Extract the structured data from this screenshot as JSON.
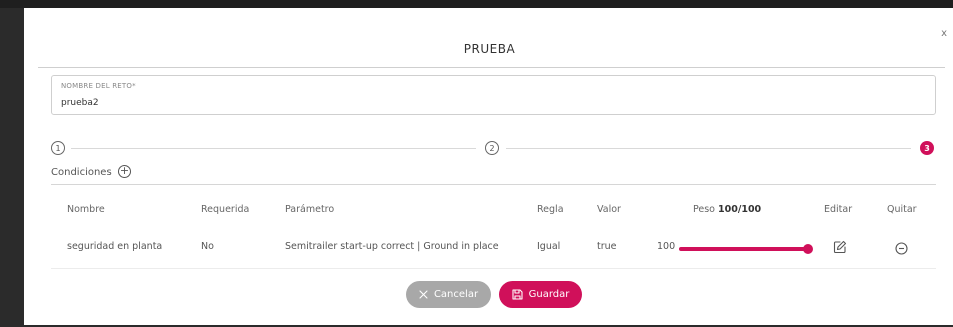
{
  "modal": {
    "title": "PRUEBA",
    "close_label": "x"
  },
  "name_field": {
    "label": "NOMBRE DEL RETO*",
    "value": "prueba2"
  },
  "steps": [
    "1",
    "2",
    "3"
  ],
  "conditions": {
    "label": "Condiciones",
    "add_label": "+"
  },
  "table": {
    "headers": {
      "nombre": "Nombre",
      "requerida": "Requerida",
      "parametro": "Parámetro",
      "regla": "Regla",
      "valor": "Valor",
      "peso": "Peso",
      "peso_total": "100/100",
      "editar": "Editar",
      "quitar": "Quitar"
    },
    "rows": [
      {
        "nombre": "seguridad en planta",
        "requerida": "No",
        "parametro": "Semitrailer start-up correct | Ground in place",
        "regla": "Igual",
        "valor": "true",
        "peso": "100",
        "peso_fraction": 1.0
      }
    ]
  },
  "buttons": {
    "cancel": "Cancelar",
    "save": "Guardar"
  },
  "colors": {
    "accent": "#d0105a",
    "cancel": "#a8a8a8"
  }
}
